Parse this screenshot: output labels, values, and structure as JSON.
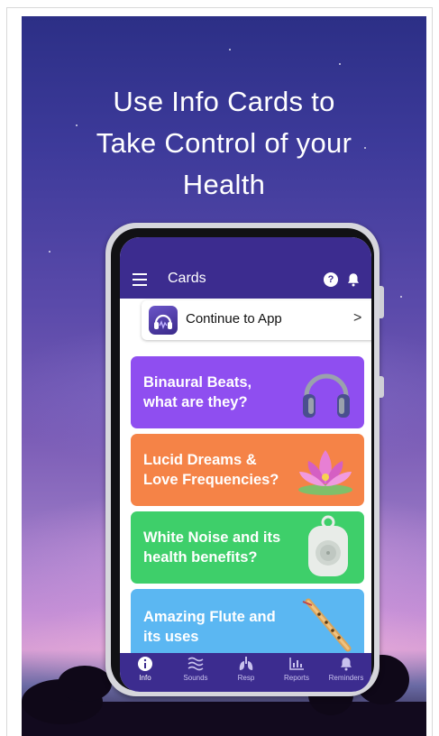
{
  "headline": [
    "Use Info Cards to",
    "Take Control of your",
    "Health"
  ],
  "appbar": {
    "title": "Cards",
    "help_glyph": "?"
  },
  "continue": {
    "label": "Continue to App",
    "chevron": ">"
  },
  "cards": [
    {
      "line1": "Binaural Beats,",
      "line2": "what are they?",
      "color": "#8f4ef0",
      "icon": "headphones-icon"
    },
    {
      "line1": "Lucid Dreams &",
      "line2": "Love Frequencies?",
      "color": "#f58347",
      "icon": "lotus-icon"
    },
    {
      "line1": "White Noise and its",
      "line2": "health benefits?",
      "color": "#3ecf6a",
      "icon": "white-noise-machine-icon"
    },
    {
      "line1": "Amazing Flute and",
      "line2": "its uses",
      "color": "#5bb7f2",
      "icon": "flute-icon"
    }
  ],
  "nav": [
    {
      "label": "Info",
      "icon": "info-icon",
      "active": true
    },
    {
      "label": "Sounds",
      "icon": "waves-icon",
      "active": false
    },
    {
      "label": "Resp",
      "icon": "lungs-icon",
      "active": false
    },
    {
      "label": "Reports",
      "icon": "bar-chart-icon",
      "active": false
    },
    {
      "label": "Reminders",
      "icon": "bell-icon",
      "active": false
    }
  ],
  "colors": {
    "brand": "#3c2c8f",
    "sky_top": "#2c2f86",
    "sky_bottom": "#d79ed4"
  }
}
